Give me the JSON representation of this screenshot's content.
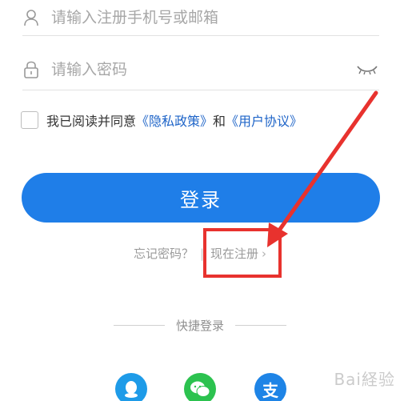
{
  "form": {
    "username_placeholder": "请输入注册手机号或邮箱",
    "password_placeholder": "请输入密码",
    "agreement_prefix": "我已阅读并同意",
    "privacy_policy": "《隐私政策》",
    "and": "和",
    "user_agreement": "《用户协议》",
    "login_button": "登录"
  },
  "links": {
    "forgot_password": "忘记密码？",
    "separator": "|",
    "register_now": "现在注册",
    "chevron": "›"
  },
  "quick_login": {
    "label": "快捷登录",
    "providers": [
      {
        "name": "qq-icon",
        "glyph": "◆"
      },
      {
        "name": "wechat-icon",
        "glyph": "●●"
      },
      {
        "name": "alipay-icon",
        "glyph": "支"
      }
    ]
  },
  "watermark": "Bai経验",
  "colors": {
    "primary_button": "#1f7ee8",
    "link": "#1e64c8",
    "annotation": "#e8322e"
  }
}
